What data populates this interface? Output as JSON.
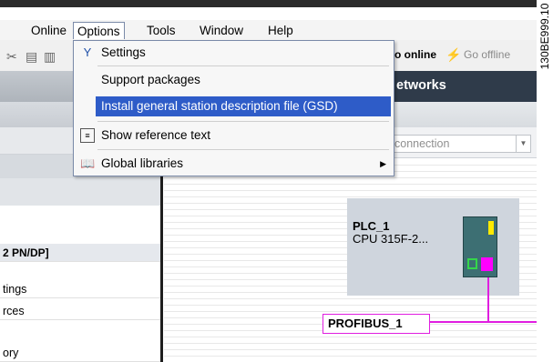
{
  "menubar": {
    "items": [
      "Online",
      "Options",
      "Tools",
      "Window",
      "Help"
    ]
  },
  "toolbar": {
    "go_online": "o online",
    "go_offline": "Go offline"
  },
  "options_menu": {
    "items": [
      {
        "label": "Settings",
        "icon": "wrench-icon"
      },
      {
        "label": "Support packages",
        "icon": ""
      },
      {
        "label": "Install general station description file (GSD)",
        "icon": "",
        "highlighted": true
      },
      {
        "label": "Show reference text",
        "icon": "reference-text-icon"
      },
      {
        "label": "Global libraries",
        "icon": "book-icon",
        "has_submenu": true
      }
    ]
  },
  "network_view": {
    "header_title": "etworks",
    "connection_select": "connection",
    "plc_name": "PLC_1",
    "plc_type": "CPU 315F-2...",
    "bus_label": "PROFIBUS_1"
  },
  "left_panel": {
    "rows": [
      "2 PN/DP]",
      "tings",
      "rces",
      "ory"
    ]
  },
  "figure_code": "130BE999.10",
  "colors": {
    "menu_highlight": "#2e5cc8",
    "header_dark": "#2f3b4a",
    "profibus": "#e01ee0",
    "plc_module": "#3d6f73"
  }
}
